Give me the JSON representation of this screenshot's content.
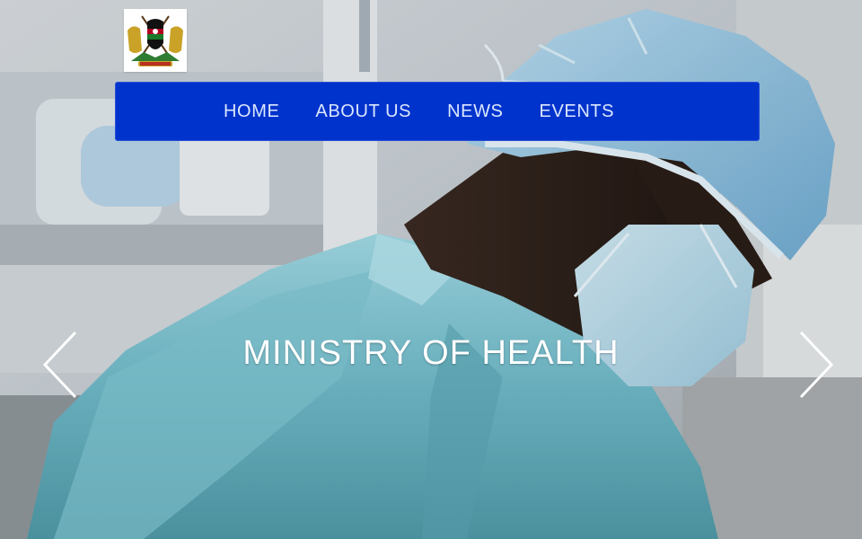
{
  "header": {
    "logo": {
      "icon": "kenya-coat-of-arms-icon",
      "alt": "Coat of arms"
    }
  },
  "nav": {
    "items": [
      {
        "label": "HOME"
      },
      {
        "label": "ABOUT US"
      },
      {
        "label": "NEWS"
      },
      {
        "label": "EVENTS"
      }
    ],
    "background_color": "#0033cc",
    "text_color": "#dbe7ff"
  },
  "hero": {
    "caption": "MINISTRY OF HEALTH",
    "prev_icon": "chevron-left-icon",
    "next_icon": "chevron-right-icon"
  }
}
